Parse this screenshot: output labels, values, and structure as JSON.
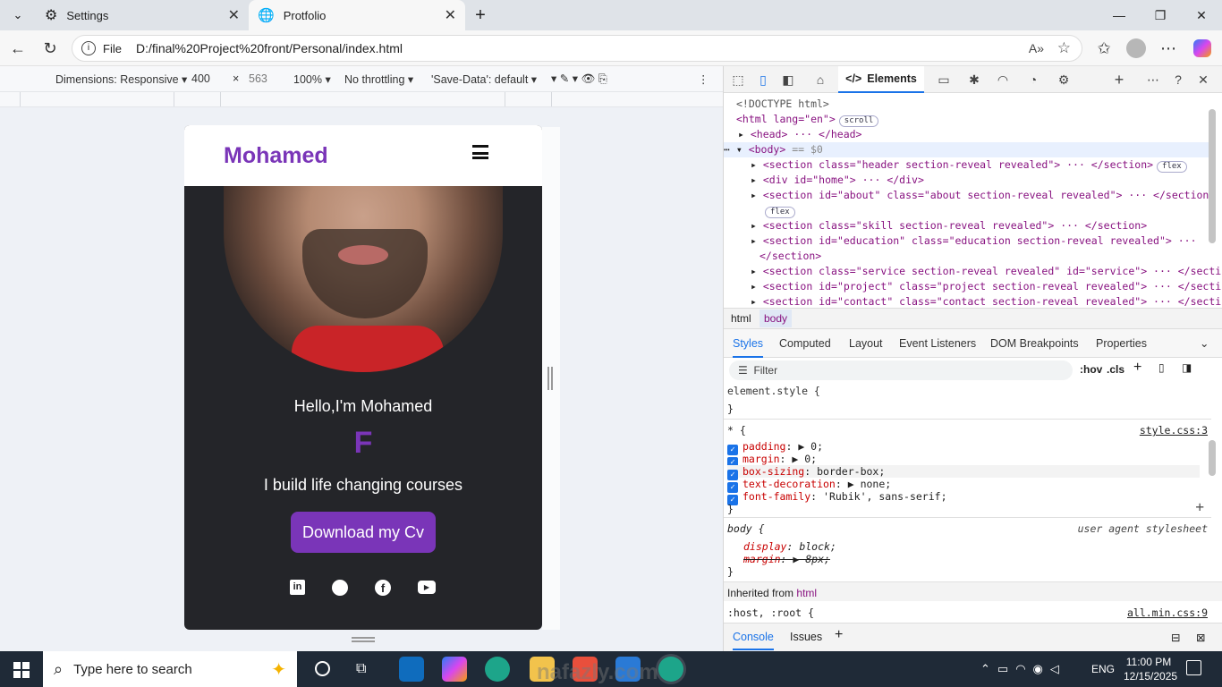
{
  "browser": {
    "tabs": [
      {
        "label": "Settings",
        "active": false
      },
      {
        "label": "Protfolio",
        "active": true
      }
    ],
    "address": {
      "scheme_label": "File",
      "url": "D:/final%20Project%20front/Personal/index.html"
    }
  },
  "device_toolbar": {
    "dimensions": "Dimensions: Responsive",
    "width": "400",
    "times": "×",
    "height": "563",
    "zoom": "100%",
    "throttling": "No throttling",
    "save_data": "'Save-Data': default"
  },
  "site": {
    "brand": "Mohamed",
    "hello": "Hello,I'm Mohamed",
    "typed": "F",
    "tagline": "I build life changing courses",
    "cta": "Download my Cv",
    "social": [
      "linkedin-icon",
      "github-icon",
      "facebook-icon",
      "youtube-icon"
    ],
    "accent_color": "#7a35b8"
  },
  "devtools": {
    "active_tab": "Elements",
    "dom": {
      "doctype": "<!DOCTYPE html>",
      "html_open": "<html lang=\"en\">",
      "html_pill": "scroll",
      "head": "<head> ··· </head>",
      "body": "<body>",
      "body_suffix": "== $0",
      "nodes": [
        "<section class=\"header section-reveal revealed\"> ··· </section>",
        "<div id=\"home\"> ··· </div>",
        "<section id=\"about\" class=\"about section-reveal revealed\"> ··· </section>",
        "<section class=\"skill section-reveal revealed\"> ··· </section>",
        "<section id=\"education\" class=\"education section-reveal revealed\"> ···",
        "</section>",
        "<section class=\"service section-reveal revealed\" id=\"service\"> ··· </section>",
        "<section id=\"project\" class=\"project section-reveal revealed\"> ··· </section>",
        "<section id=\"contact\" class=\"contact section-reveal revealed\"> ··· </section>"
      ],
      "flex_pill": "flex"
    },
    "breadcrumb": [
      "html",
      "body"
    ],
    "style_tabs": [
      "Styles",
      "Computed",
      "Layout",
      "Event Listeners",
      "DOM Breakpoints",
      "Properties"
    ],
    "filter_placeholder": "Filter",
    "filter_tools": [
      ":hov",
      ".cls"
    ],
    "rules": {
      "element_style": "element.style {",
      "close": "}",
      "star_selector": "* {",
      "star_source": "style.css:3",
      "star_props": [
        {
          "name": "padding",
          "value": "▶ 0;"
        },
        {
          "name": "margin",
          "value": "▶ 0;"
        },
        {
          "name": "box-sizing",
          "value": "border-box;"
        },
        {
          "name": "text-decoration",
          "value": "▶ none;"
        },
        {
          "name": "font-family",
          "value": "'Rubik', sans-serif;"
        }
      ],
      "body_selector": "body {",
      "body_source": "user agent stylesheet",
      "body_props": [
        {
          "name": "display",
          "value": "block;"
        },
        {
          "name": "margin",
          "value": "▶ 8px;"
        }
      ],
      "inherited": "Inherited from",
      "inherited_tag": "html",
      "host_selector": ":host, :root {",
      "host_source": "all.min.css:9"
    },
    "drawer_tabs": [
      "Console",
      "Issues"
    ]
  },
  "taskbar": {
    "search_placeholder": "Type here to search",
    "language": "ENG",
    "time": "11:00 PM",
    "date": "12/15/2025"
  },
  "watermark": "nafazly.com"
}
